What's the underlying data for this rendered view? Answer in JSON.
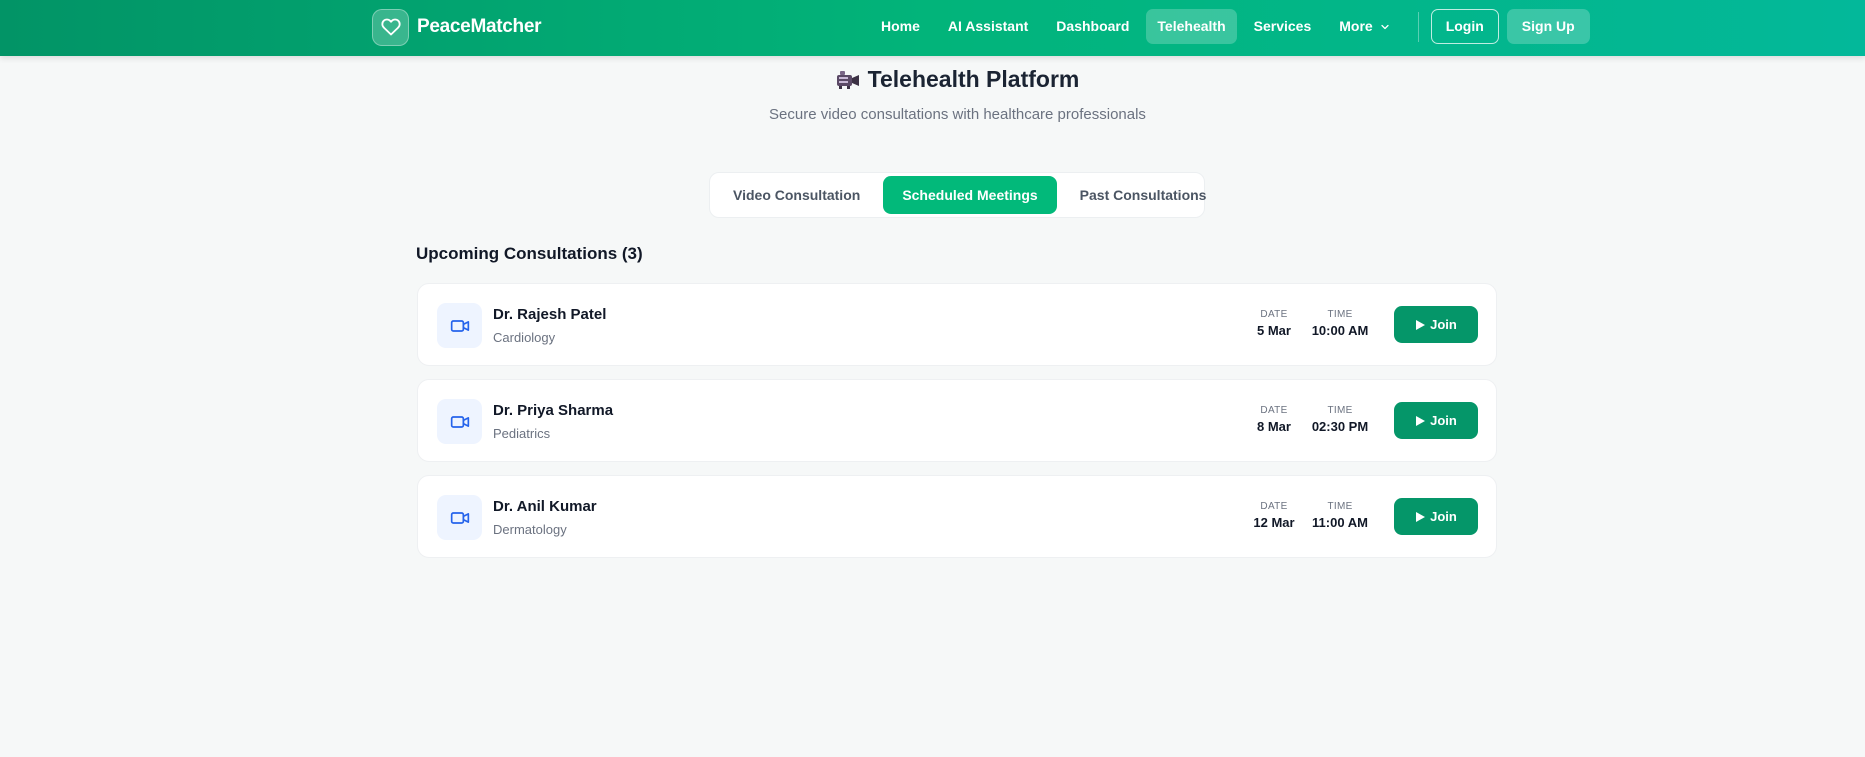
{
  "brand": {
    "name": "PeaceMatcher",
    "icon": "heart-icon"
  },
  "nav": {
    "links": [
      {
        "label": "Home",
        "active": false
      },
      {
        "label": "AI Assistant",
        "active": false
      },
      {
        "label": "Dashboard",
        "active": false
      },
      {
        "label": "Telehealth",
        "active": true
      },
      {
        "label": "Services",
        "active": false
      }
    ],
    "more_label": "More",
    "login_label": "Login",
    "signup_label": "Sign Up"
  },
  "hero": {
    "title": "Telehealth Platform",
    "title_icon": "video-camera-emoji-icon",
    "subtitle": "Secure video consultations with healthcare professionals"
  },
  "tabs": [
    {
      "label": "Video Consultation",
      "active": false
    },
    {
      "label": "Scheduled Meetings",
      "active": true
    },
    {
      "label": "Past Consultations",
      "active": false
    }
  ],
  "section": {
    "title": "Upcoming Consultations (3)"
  },
  "labels": {
    "date": "DATE",
    "time": "TIME",
    "join": "Join"
  },
  "consultations": [
    {
      "doctor": "Dr. Rajesh Patel",
      "specialty": "Cardiology",
      "date": "5 Mar",
      "time": "10:00 AM"
    },
    {
      "doctor": "Dr. Priya Sharma",
      "specialty": "Pediatrics",
      "date": "8 Mar",
      "time": "02:30 PM"
    },
    {
      "doctor": "Dr. Anil Kumar",
      "specialty": "Dermatology",
      "date": "12 Mar",
      "time": "11:00 AM"
    }
  ],
  "colors": {
    "brand_green": "#02b47a",
    "active_tab": "#02b97a",
    "join_button": "#059669",
    "video_icon": "#2563eb"
  }
}
